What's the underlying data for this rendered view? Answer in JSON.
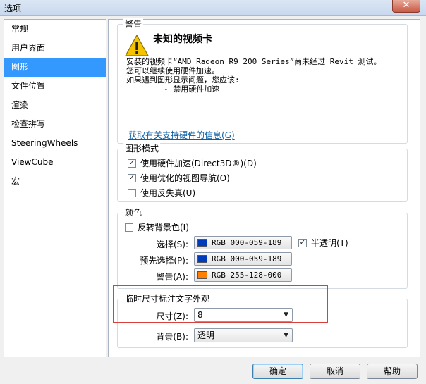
{
  "window": {
    "title": "选项",
    "close_label": "✕"
  },
  "nav": {
    "items": [
      "常规",
      "用户界面",
      "图形",
      "文件位置",
      "渲染",
      "检查拼写",
      "SteeringWheels",
      "ViewCube",
      "宏"
    ],
    "selected_index": 2
  },
  "warning": {
    "group_title": "警告",
    "title": "未知的视频卡",
    "line1": "安装的视频卡“AMD Radeon R9 200 Series”尚未经过 Revit 测试。",
    "line2": "您可以继续使用硬件加速。",
    "line3": "如果遇到图形显示问题，您应该:",
    "line4": "        - 禁用硬件加速",
    "link": "获取有关支持硬件的信息(G)"
  },
  "graphics_mode": {
    "group_title": "图形模式",
    "hardware_accel": {
      "label": "使用硬件加速(Direct3D®)(D)",
      "checked": true
    },
    "optimized_nav": {
      "label": "使用优化的视图导航(O)",
      "checked": true
    },
    "antialias": {
      "label": "使用反失真(U)",
      "checked": false
    }
  },
  "colors": {
    "group_title": "颜色",
    "invert_bg": {
      "label": "反转背景色(I)",
      "checked": false
    },
    "selection": {
      "label": "选择(S):",
      "value": "RGB 000-059-189",
      "color": "#003bbd"
    },
    "semi_transparent": {
      "label": "半透明(T)",
      "checked": true
    },
    "preselection": {
      "label": "预先选择(P):",
      "value": "RGB 000-059-189",
      "color": "#003bbd"
    },
    "alert": {
      "label": "警告(A):",
      "value": "RGB 255-128-000",
      "color": "#ff8000"
    }
  },
  "temp_dim": {
    "group_title": "临时尺寸标注文字外观",
    "size": {
      "label": "尺寸(Z):",
      "value": "8"
    },
    "background": {
      "label": "背景(B):",
      "value": "透明"
    }
  },
  "buttons": {
    "ok": "确定",
    "cancel": "取消",
    "help": "帮助"
  },
  "accent_color": "#3399ff",
  "highlight_frame_color": "#d9403b"
}
